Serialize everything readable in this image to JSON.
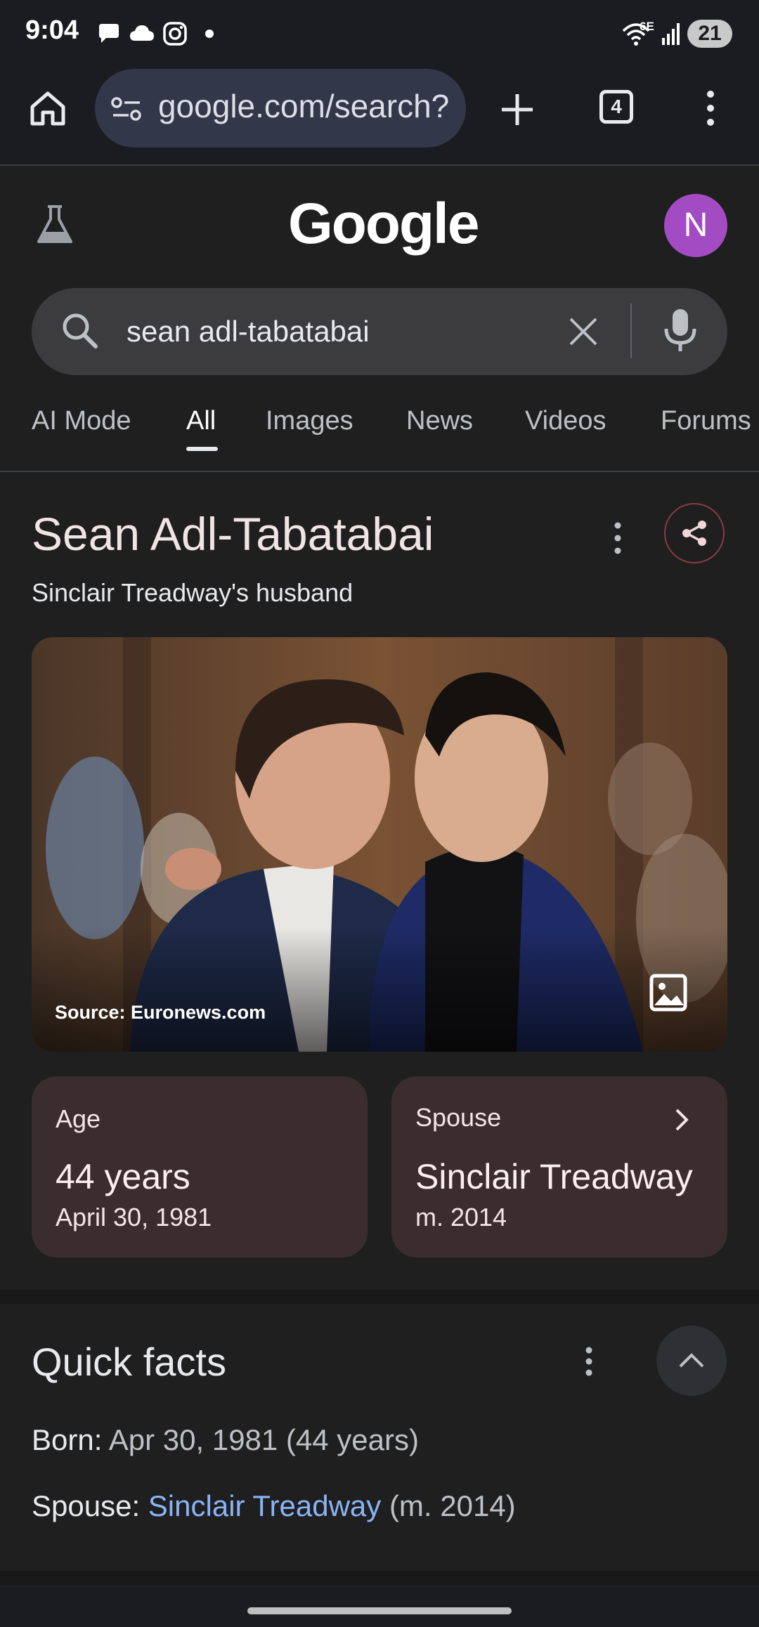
{
  "status_bar": {
    "time": "9:04",
    "left_icons": [
      "chat-bubble-icon",
      "cloud-icon",
      "instagram-icon",
      "dot-icon"
    ],
    "wifi_label": "6E",
    "battery": "21"
  },
  "browser": {
    "url": "google.com/search?",
    "tab_count": "4"
  },
  "google": {
    "logo_text": "Google",
    "avatar_letter": "N",
    "query": "sean adl-tabatabai",
    "tabs": [
      {
        "label": "AI Mode"
      },
      {
        "label": "All"
      },
      {
        "label": "Images"
      },
      {
        "label": "News"
      },
      {
        "label": "Videos"
      },
      {
        "label": "Forums"
      }
    ],
    "active_tab": "All"
  },
  "knowledge_panel": {
    "title": "Sean Adl-Tabatabai",
    "subtitle": "Sinclair Treadway's husband",
    "image_source": "Source: Euronews.com",
    "cards": [
      {
        "label": "Age",
        "value": "44 years",
        "sub": "April 30, 1981"
      },
      {
        "label": "Spouse",
        "value": "Sinclair Treadway",
        "sub": "m. 2014"
      }
    ]
  },
  "quick_facts": {
    "title": "Quick facts",
    "born_label": "Born",
    "born_value": "Apr 30, 1981 (44 years)",
    "spouse_label": "Spouse",
    "spouse_link": "Sinclair Treadway",
    "spouse_suffix": "(m. 2014)"
  },
  "colors": {
    "accent_link": "#8ab4f8",
    "avatar_bg": "#a34bc2",
    "card_bg": "#3b2d2f"
  }
}
